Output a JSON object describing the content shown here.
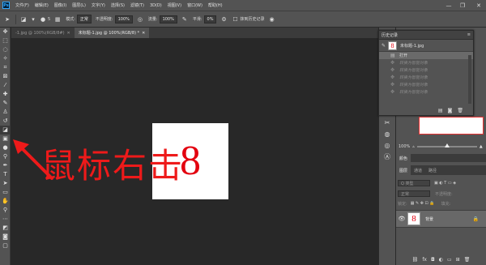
{
  "app": {
    "logo": "Ps"
  },
  "menu": [
    "文件(F)",
    "编辑(E)",
    "图像(I)",
    "图层(L)",
    "文字(Y)",
    "选择(S)",
    "滤镜(T)",
    "3D(D)",
    "视图(V)",
    "窗口(W)",
    "帮助(H)"
  ],
  "window_controls": {
    "minimize": "—",
    "restore": "❐",
    "close": "✕"
  },
  "options": {
    "brush_size": "5",
    "mode_label": "模式:",
    "mode_value": "正常",
    "opacity_label": "不透明度:",
    "opacity_value": "100%",
    "flow_label": "流量:",
    "flow_value": "100%",
    "smooth_label": "平滑:",
    "smooth_value": "0%",
    "erase_history_label": "抹到历史记录"
  },
  "tabs": [
    {
      "label": "-1.jpg @ 100%(RGB/8#)",
      "active": false
    },
    {
      "label": "未标题-1.jpg @ 100%(RGB/8) *",
      "active": true
    }
  ],
  "canvas": {
    "document_text": "8"
  },
  "annotation": {
    "text": "鼠标右击",
    "color": "#ee1a1a"
  },
  "history": {
    "title": "历史记录",
    "snapshot": {
      "name": "未标题-1.jpg",
      "thumb": "8"
    },
    "items": [
      {
        "label": "打开",
        "state": "active"
      },
      {
        "label": "转换为智能对象",
        "state": "dim"
      },
      {
        "label": "转换为智能对象",
        "state": "dim"
      },
      {
        "label": "转换为智能对象",
        "state": "dim"
      },
      {
        "label": "转换为智能对象",
        "state": "dim"
      },
      {
        "label": "转换为智能对象",
        "state": "dim"
      }
    ]
  },
  "navigator": {
    "zoom": "100%"
  },
  "color_panel": {
    "tab": "颜色"
  },
  "layers": {
    "tabs": [
      "图层",
      "通道",
      "路径"
    ],
    "kind_placeholder": "Q 类型",
    "blend_mode": "正常",
    "opacity_label": "不透明度:",
    "lock_label": "锁定:",
    "fill_label": "填充:",
    "layer": {
      "name": "背景",
      "thumb": "8"
    }
  }
}
